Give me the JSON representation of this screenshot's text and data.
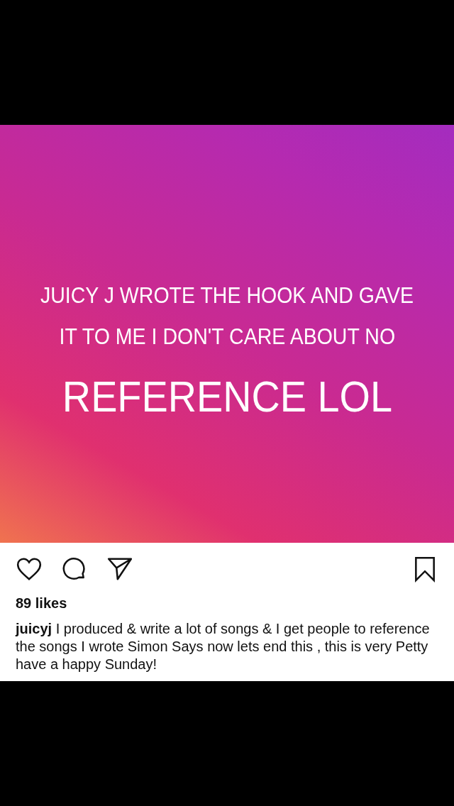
{
  "post": {
    "image_lines": [
      {
        "text": "JUICY J WROTE THE HOOK AND GAVE",
        "kind": "small"
      },
      {
        "text": "IT TO ME I DON'T CARE ABOUT NO",
        "kind": "small"
      },
      {
        "text": "REFERENCE LOL",
        "kind": "large"
      }
    ],
    "liked": false,
    "saved": false,
    "likes": "89 likes",
    "caption": "**juicyj** I produced & write a lot of songs & I get people to reference the songs I wrote Simon Says  now lets end this , this is very Petty have a happy Sunday!"
  }
}
